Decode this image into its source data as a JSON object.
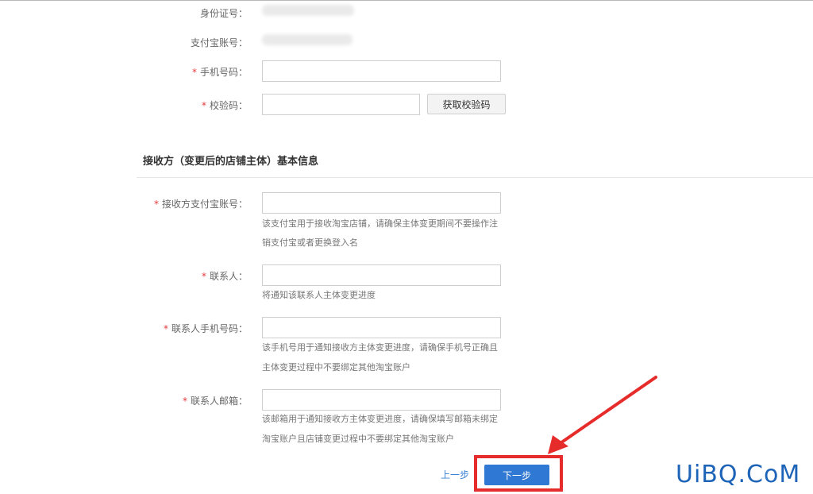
{
  "fields": {
    "id_number": {
      "label": "身份证号："
    },
    "alipay_account": {
      "label": "支付宝账号："
    },
    "phone": {
      "label": "手机号码：",
      "required_mark": "*",
      "value": ""
    },
    "verify_code": {
      "label": "校验码：",
      "required_mark": "*",
      "value": "",
      "button_label": "获取校验码"
    }
  },
  "receiver_section": {
    "title": "接收方（变更后的店铺主体）基本信息",
    "alipay": {
      "label": "接收方支付宝账号：",
      "required_mark": "*",
      "value": "",
      "hint_line1": "该支付宝用于接收淘宝店铺，请确保主体变更期间不要操作注",
      "hint_line2": "销支付宝或者更换登入名"
    },
    "contact": {
      "label": "联系人：",
      "required_mark": "*",
      "value": "",
      "hint_line1": "将通知该联系人主体变更进度"
    },
    "contact_phone": {
      "label": "联系人手机号码：",
      "required_mark": "*",
      "value": "",
      "hint_line1": "该手机号用于通知接收方主体变更进度，请确保手机号正确且",
      "hint_line2": "主体变更过程中不要绑定其他淘宝账户"
    },
    "contact_email": {
      "label": "联系人邮箱：",
      "required_mark": "*",
      "value": "",
      "hint_line1": "该邮箱用于通知接收方主体变更进度，请确保填写邮箱未绑定",
      "hint_line2": "淘宝账户且店铺变更过程中不要绑定其他淘宝账户"
    }
  },
  "actions": {
    "prev_label": "上一步",
    "next_label": "下一步"
  },
  "watermark": "UiBQ.CoM",
  "colors": {
    "required": "#e4393c",
    "primary": "#2f78d3",
    "link": "#3a82d6",
    "highlight": "#e62b2b"
  }
}
